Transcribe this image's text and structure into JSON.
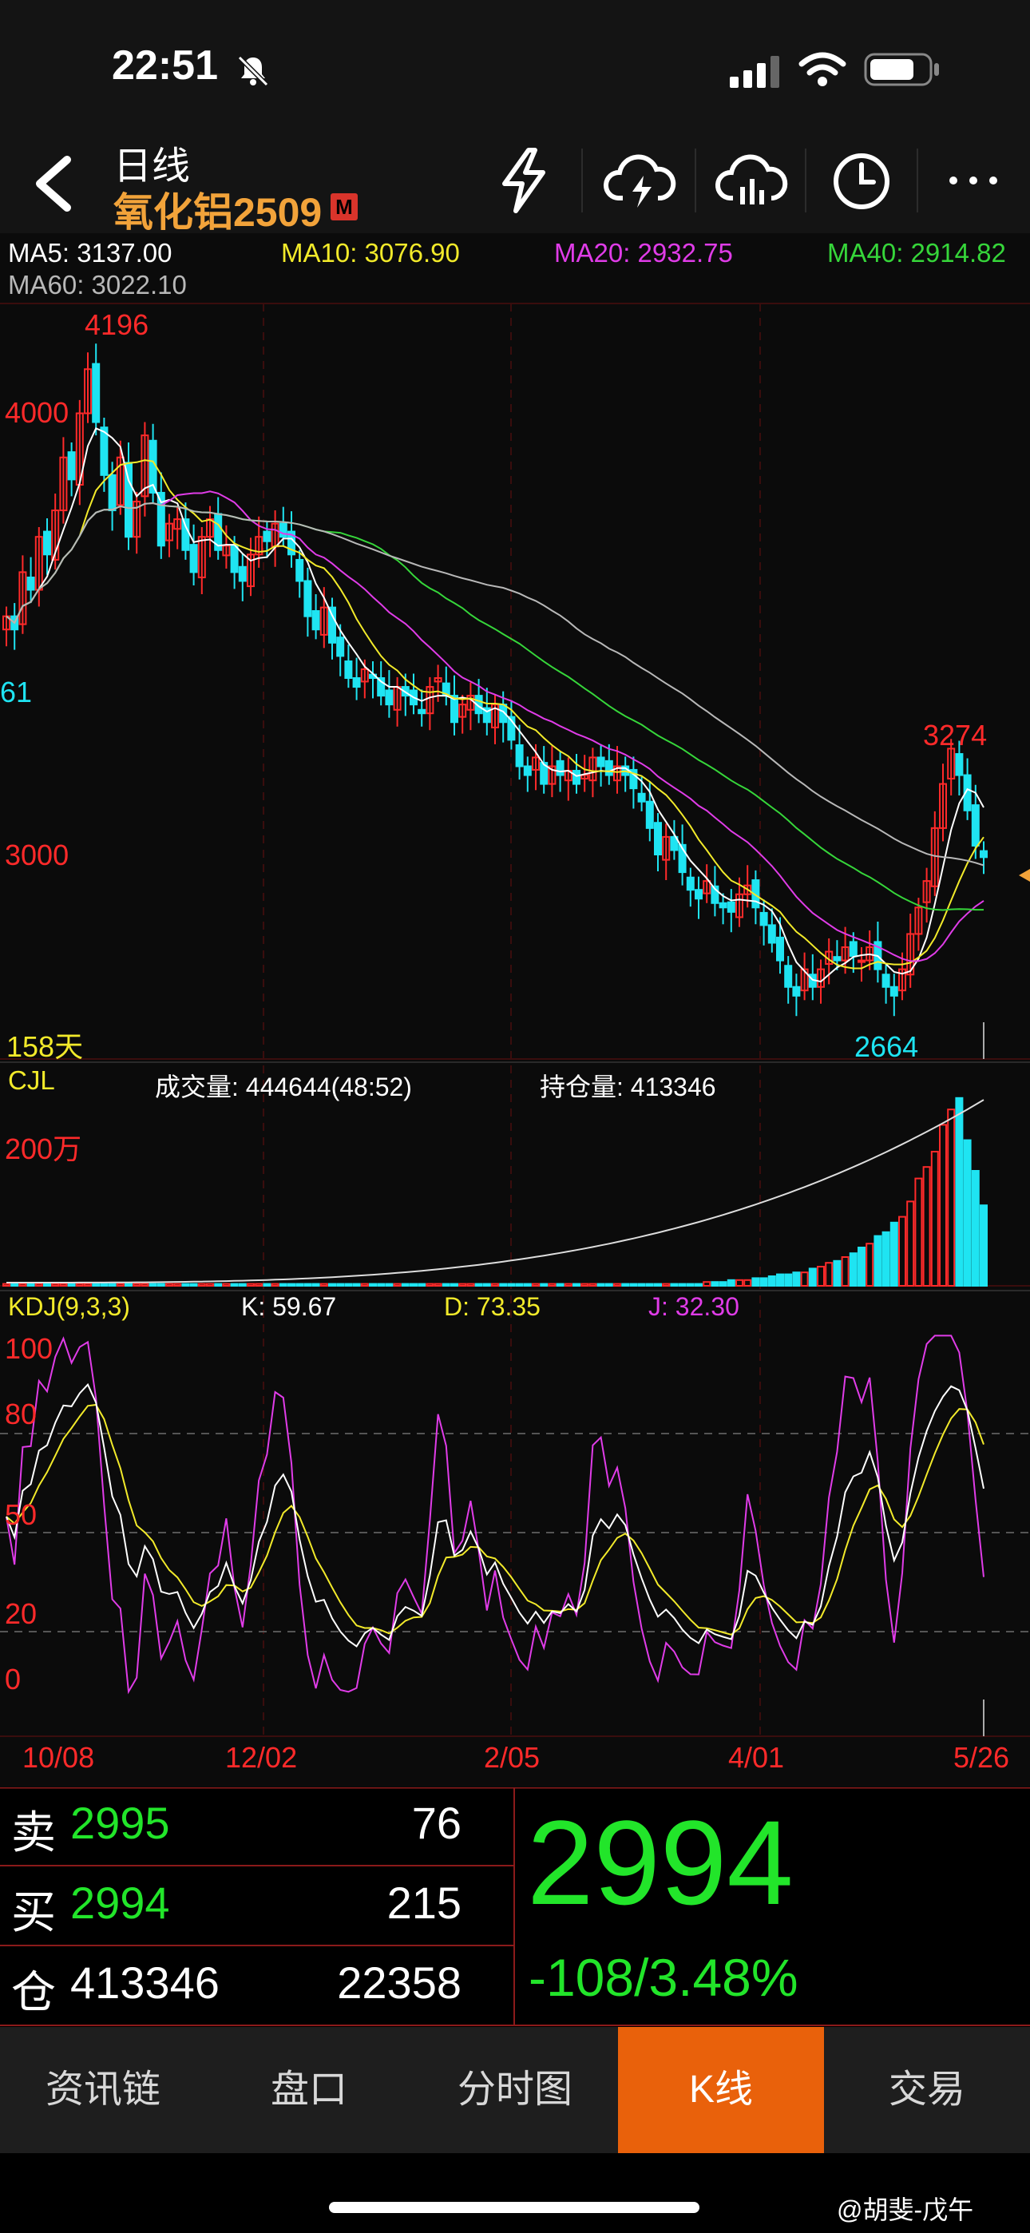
{
  "status_bar": {
    "time": "22:51"
  },
  "header": {
    "title": "日线",
    "contract": "氧化铝2509",
    "badge": "M"
  },
  "ma_legend": {
    "ma5": "MA5: 3137.00",
    "ma10": "MA10: 3076.90",
    "ma20": "MA20: 2932.75",
    "ma40": "MA40: 2914.82",
    "ma60": "MA60: 3022.10"
  },
  "price_chart": {
    "high_label": "4196",
    "low_label": "2664",
    "recent_high_label": "3274",
    "axis_4000": "4000",
    "axis_61": "61",
    "axis_3000": "3000",
    "days_label": "158天"
  },
  "volume_panel": {
    "name": "CJL",
    "volume_text": "成交量: 444644(48:52)",
    "oi_text": "持仓量: 413346",
    "scale_label": "200万"
  },
  "kdj_panel": {
    "name": "KDJ(9,3,3)",
    "k": "K: 59.67",
    "d": "D: 73.35",
    "j": "J: 32.30",
    "levels": [
      "100",
      "80",
      "50",
      "20",
      "0"
    ]
  },
  "x_axis": {
    "dates": [
      "10/08",
      "12/02",
      "2/05",
      "4/01",
      "5/26"
    ]
  },
  "quote": {
    "sell_label": "卖",
    "sell_price": "2995",
    "sell_qty": "76",
    "buy_label": "买",
    "buy_price": "2994",
    "buy_qty": "215",
    "oi_label": "仓",
    "oi_value": "413346",
    "oi_change": "22358",
    "last_price": "2994",
    "change": "-108/3.48%"
  },
  "tabs": [
    "资讯链",
    "盘口",
    "分时图",
    "K线",
    "交易"
  ],
  "active_tab": "K线",
  "watermark": "@胡斐-戊午",
  "colors": {
    "up": "#ff2a2a",
    "down": "#1fe4f2",
    "green": "#22e52a",
    "ma5": "#ffffff",
    "ma10": "#f2ea2a",
    "ma20": "#e03ce8",
    "ma40": "#36d63a",
    "ma60": "#b8b8b8",
    "active_tab": "#e9610b",
    "contract": "#f2a33a"
  },
  "series": {
    "close": [
      3540,
      3510,
      3640,
      3600,
      3720,
      3680,
      3780,
      3900,
      3850,
      4000,
      4100,
      3980,
      3860,
      3780,
      3900,
      3720,
      3800,
      3950,
      3820,
      3700,
      3750,
      3760,
      3690,
      3640,
      3720,
      3760,
      3690,
      3700,
      3640,
      3620,
      3680,
      3720,
      3710,
      3750,
      3720,
      3680,
      3620,
      3540,
      3510,
      3560,
      3480,
      3450,
      3400,
      3380,
      3420,
      3400,
      3360,
      3340,
      3380,
      3360,
      3340,
      3320,
      3380,
      3400,
      3360,
      3300,
      3340,
      3360,
      3320,
      3300,
      3340,
      3300,
      3260,
      3200,
      3180,
      3220,
      3160,
      3200,
      3180,
      3190,
      3160,
      3180,
      3220,
      3200,
      3180,
      3200,
      3180,
      3150,
      3120,
      3060,
      3000,
      3040,
      3010,
      2960,
      2920,
      2900,
      2940,
      2890,
      2880,
      2870,
      2910,
      2930,
      2880,
      2840,
      2800,
      2760,
      2700,
      2680,
      2740,
      2700,
      2740,
      2780,
      2760,
      2790,
      2770,
      2760,
      2790,
      2740,
      2700,
      2680,
      2740,
      2820,
      2880,
      2940,
      3060,
      3160,
      3240,
      3180,
      3100,
      3020,
      2994
    ],
    "volume": [
      0.01,
      0.01,
      0.01,
      0.01,
      0.01,
      0.01,
      0.01,
      0.01,
      0.01,
      0.01,
      0.01,
      0.01,
      0.01,
      0.01,
      0.01,
      0.01,
      0.01,
      0.01,
      0.01,
      0.01,
      0.01,
      0.01,
      0.01,
      0.01,
      0.01,
      0.01,
      0.01,
      0.01,
      0.01,
      0.01,
      0.01,
      0.01,
      0.01,
      0.01,
      0.01,
      0.01,
      0.01,
      0.01,
      0.01,
      0.01,
      0.01,
      0.01,
      0.01,
      0.01,
      0.01,
      0.01,
      0.01,
      0.01,
      0.01,
      0.01,
      0.01,
      0.01,
      0.01,
      0.01,
      0.01,
      0.01,
      0.01,
      0.01,
      0.01,
      0.01,
      0.01,
      0.01,
      0.01,
      0.01,
      0.01,
      0.01,
      0.01,
      0.01,
      0.01,
      0.01,
      0.01,
      0.01,
      0.01,
      0.01,
      0.01,
      0.01,
      0.01,
      0.01,
      0.01,
      0.01,
      0.01,
      0.01,
      0.01,
      0.01,
      0.01,
      0.01,
      0.02,
      0.02,
      0.02,
      0.03,
      0.03,
      0.03,
      0.04,
      0.04,
      0.05,
      0.06,
      0.06,
      0.07,
      0.07,
      0.09,
      0.1,
      0.12,
      0.13,
      0.15,
      0.17,
      0.2,
      0.22,
      0.26,
      0.28,
      0.33,
      0.36,
      0.44,
      0.56,
      0.62,
      0.7,
      0.84,
      0.92,
      0.98,
      0.76,
      0.6,
      0.42
    ]
  }
}
